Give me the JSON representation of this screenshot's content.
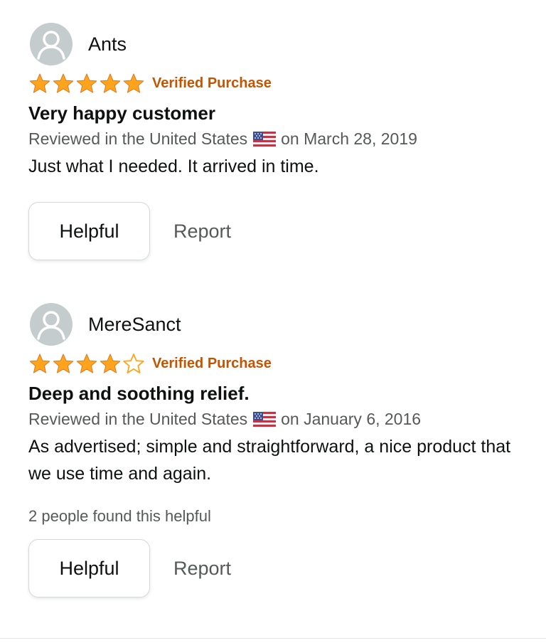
{
  "colors": {
    "star": "#ffa41c",
    "verified": "#c45500",
    "meta": "#565959",
    "text": "#0f1111",
    "avatar_bg": "#c5ccce"
  },
  "reviews": [
    {
      "author": "Ants",
      "avatar_icon": "user-silhouette-icon",
      "rating": 5,
      "max_rating": 5,
      "verified_label": "Verified Purchase",
      "title": "Very happy customer",
      "reviewed_in": "Reviewed in the United States",
      "flag_icon": "us-flag-icon",
      "date": "on March 28, 2019",
      "body": "Just what I needed. It arrived in time.",
      "helpful_count_text": "",
      "helpful_label": "Helpful",
      "report_label": "Report"
    },
    {
      "author": "MereSanct",
      "avatar_icon": "user-silhouette-icon",
      "rating": 4,
      "max_rating": 5,
      "verified_label": "Verified Purchase",
      "title": "Deep and soothing relief.",
      "reviewed_in": "Reviewed in the United States",
      "flag_icon": "us-flag-icon",
      "date": "on January 6, 2016",
      "body": "As advertised; simple and straightforward, a nice product that we use time and again.",
      "helpful_count_text": "2 people found this helpful",
      "helpful_label": "Helpful",
      "report_label": "Report"
    }
  ]
}
